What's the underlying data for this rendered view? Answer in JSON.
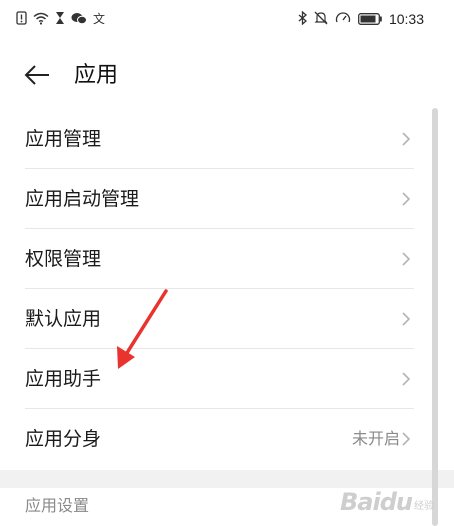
{
  "status_bar": {
    "time": "10:33",
    "left_icons": [
      "sim-alert-icon",
      "wifi-icon",
      "hourglass-icon",
      "wechat-icon",
      "character-icon"
    ],
    "right_icons": [
      "bluetooth-icon",
      "mute-icon",
      "speed-icon",
      "battery-icon"
    ]
  },
  "header": {
    "title": "应用",
    "back_icon": "back-arrow-icon"
  },
  "list": {
    "items": [
      {
        "label": "应用管理",
        "value": ""
      },
      {
        "label": "应用启动管理",
        "value": ""
      },
      {
        "label": "权限管理",
        "value": ""
      },
      {
        "label": "默认应用",
        "value": ""
      },
      {
        "label": "应用助手",
        "value": ""
      },
      {
        "label": "应用分身",
        "value": "未开启"
      }
    ]
  },
  "section": {
    "header": "应用设置"
  },
  "annotation": {
    "color": "#e8332e",
    "icon": "red-arrow-annotation"
  },
  "watermark": {
    "text": "Baidu",
    "sub": "经验"
  },
  "colors": {
    "text_primary": "#1a1a1a",
    "text_secondary": "#8a8a8a",
    "divider": "#e7e7e7",
    "chevron": "#b4b4b4"
  }
}
